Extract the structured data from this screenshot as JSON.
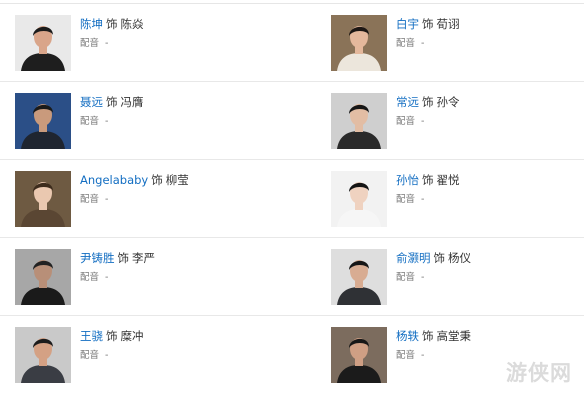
{
  "cast": [
    {
      "actor": "陈坤",
      "sep": "饰",
      "role": "陈焱",
      "dub_label": "配音",
      "dub_value": "-",
      "photo": {
        "bg": "#e9e9e9",
        "hair": "#1b1b1b",
        "skin": "#d9a58a",
        "cloth": "#1e1e1e"
      }
    },
    {
      "actor": "白宇",
      "sep": "饰",
      "role": "荀诩",
      "dub_label": "配音",
      "dub_value": "-",
      "photo": {
        "bg": "#8a7358",
        "hair": "#1d1714",
        "skin": "#e4b89c",
        "cloth": "#ece6dc"
      }
    },
    {
      "actor": "聂远",
      "sep": "饰",
      "role": "冯膺",
      "dub_label": "配音",
      "dub_value": "-",
      "photo": {
        "bg": "#2b4f87",
        "hair": "#1a1a1a",
        "skin": "#c99a7c",
        "cloth": "#1f2530"
      }
    },
    {
      "actor": "常远",
      "sep": "饰",
      "role": "孙令",
      "dub_label": "配音",
      "dub_value": "-",
      "photo": {
        "bg": "#cfcfcf",
        "hair": "#161616",
        "skin": "#e2bda4",
        "cloth": "#2a2a2a"
      }
    },
    {
      "actor": "Angelababy",
      "sep": "饰",
      "role": "柳莹",
      "dub_label": "配音",
      "dub_value": "-",
      "photo": {
        "bg": "#6e5a42",
        "hair": "#3c2b1c",
        "skin": "#eac8b0",
        "cloth": "#5a4633"
      }
    },
    {
      "actor": "孙怡",
      "sep": "饰",
      "role": "翟悦",
      "dub_label": "配音",
      "dub_value": "-",
      "photo": {
        "bg": "#f2f2f2",
        "hair": "#141414",
        "skin": "#efd2c0",
        "cloth": "#f6f6f6"
      }
    },
    {
      "actor": "尹铸胜",
      "sep": "饰",
      "role": "李严",
      "dub_label": "配音",
      "dub_value": "-",
      "photo": {
        "bg": "#a7a7a7",
        "hair": "#222222",
        "skin": "#b88f78",
        "cloth": "#1a1a1a"
      }
    },
    {
      "actor": "俞灏明",
      "sep": "饰",
      "role": "杨仪",
      "dub_label": "配音",
      "dub_value": "-",
      "photo": {
        "bg": "#dedede",
        "hair": "#161616",
        "skin": "#d8ac92",
        "cloth": "#2f3135"
      }
    },
    {
      "actor": "王骁",
      "sep": "饰",
      "role": "糜冲",
      "dub_label": "配音",
      "dub_value": "-",
      "photo": {
        "bg": "#c9c9c9",
        "hair": "#1c1c1c",
        "skin": "#d4a184",
        "cloth": "#3a3d44"
      }
    },
    {
      "actor": "杨轶",
      "sep": "饰",
      "role": "高堂秉",
      "dub_label": "配音",
      "dub_value": "-",
      "photo": {
        "bg": "#7c6c5e",
        "hair": "#171717",
        "skin": "#cf9f84",
        "cloth": "#1b1b1b"
      }
    }
  ],
  "watermark": "游侠网"
}
